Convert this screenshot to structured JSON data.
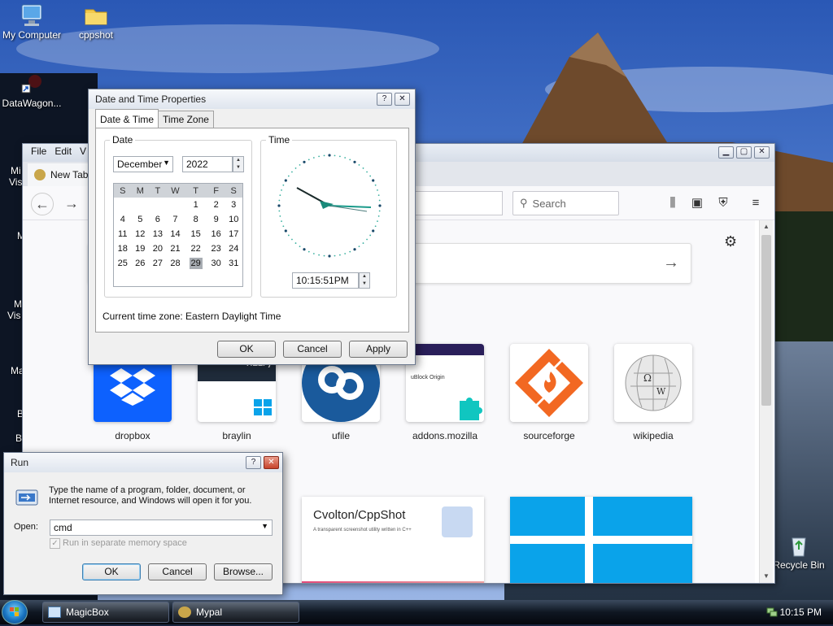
{
  "desktop": {
    "icons": [
      {
        "label": "My Computer",
        "icon": "computer-icon"
      },
      {
        "label": "cppshot",
        "icon": "folder-icon"
      },
      {
        "label": "DataWagon...",
        "icon": "shortcut-icon"
      },
      {
        "label": "Recycle Bin",
        "icon": "recycle-bin-icon"
      }
    ],
    "partial_labels": [
      "Mi",
      "Vis",
      "M",
      "M",
      "Vis",
      "Ma",
      "B",
      "B"
    ]
  },
  "browser": {
    "menu": [
      "File",
      "Edit",
      "V"
    ],
    "tab_title": "New Tab",
    "search_placeholder": "Search",
    "tiles": [
      {
        "label": "dropbox"
      },
      {
        "label": "braylin",
        "overlay": "TO HELP)"
      },
      {
        "label": "ufile"
      },
      {
        "label": "addons.mozilla",
        "sub": "uBlock Origin"
      },
      {
        "label": "sourceforge"
      },
      {
        "label": "wikipedia"
      }
    ],
    "cppshot_card": {
      "title": "Cvolton/CppShot",
      "subtitle": "A transparent screenshot utility written in C++"
    }
  },
  "datetime_dialog": {
    "title": "Date and Time Properties",
    "help": "?",
    "close": "✕",
    "tabs": [
      "Date & Time",
      "Time Zone"
    ],
    "date_group": "Date",
    "time_group": "Time",
    "month": "December",
    "year": "2022",
    "weekdays": [
      "S",
      "M",
      "T",
      "W",
      "T",
      "F",
      "S"
    ],
    "weeks": [
      [
        "",
        "",
        "",
        "",
        "1",
        "2",
        "3"
      ],
      [
        "4",
        "5",
        "6",
        "7",
        "8",
        "9",
        "10"
      ],
      [
        "11",
        "12",
        "13",
        "14",
        "15",
        "16",
        "17"
      ],
      [
        "18",
        "19",
        "20",
        "21",
        "22",
        "23",
        "24"
      ],
      [
        "25",
        "26",
        "27",
        "28",
        "29",
        "30",
        "31"
      ]
    ],
    "selected_day": "29",
    "time_value": "10:15:51PM",
    "timezone_label": "Current time zone:  Eastern Daylight Time",
    "ok": "OK",
    "cancel": "Cancel",
    "apply": "Apply"
  },
  "run_dialog": {
    "title": "Run",
    "help": "?",
    "close": "✕",
    "description": "Type the name of a program, folder, document, or Internet resource, and Windows will open it for you.",
    "open_label": "Open:",
    "open_value": "cmd",
    "checkbox_label": "Run in separate memory space",
    "ok": "OK",
    "cancel": "Cancel",
    "browse": "Browse..."
  },
  "taskbar": {
    "tasks": [
      {
        "label": "MagicBox",
        "icon": "window-app-icon"
      },
      {
        "label": "Mypal",
        "icon": "mypal-icon"
      }
    ],
    "clock": "10:15 PM"
  },
  "colors": {
    "dropbox": "#0d61fe",
    "ufile": "#1a5a9c",
    "sourceforge": "#f26822",
    "windows_tile": "#0aa3ea"
  }
}
